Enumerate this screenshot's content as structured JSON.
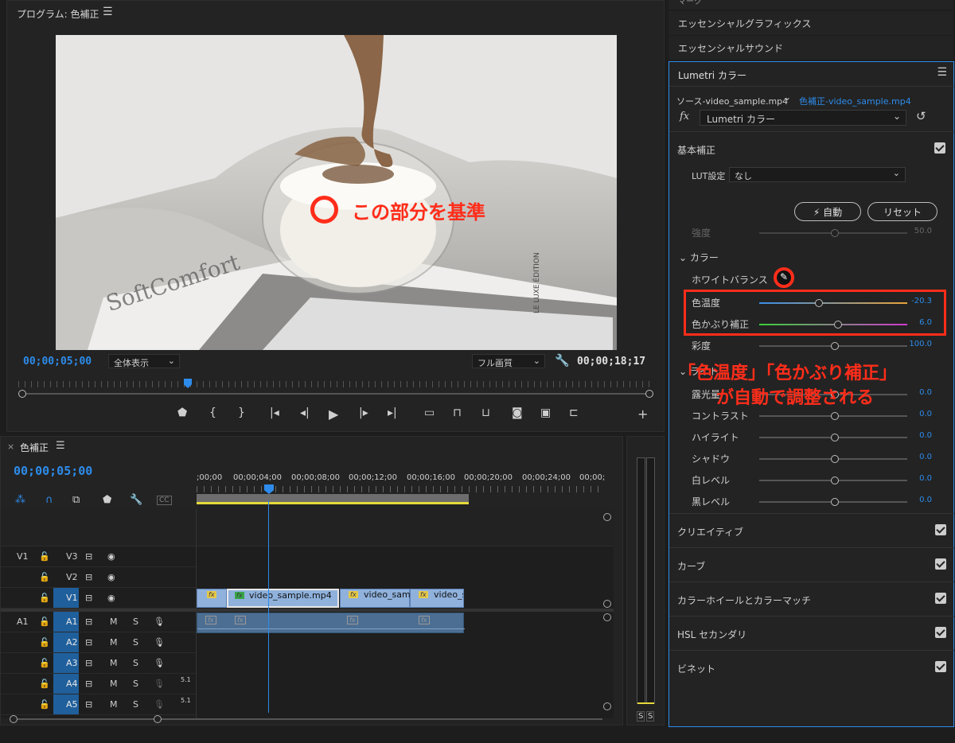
{
  "program": {
    "title": "プログラム: 色補正",
    "timecode_left": "00;00;05;00",
    "fit": "全体表示",
    "quality": "フル画質",
    "timecode_right": "00;00;18;17",
    "overlay_text": "この部分を基準",
    "cover_text": "SoftComfort",
    "side_text": "LE LUXE ÉDITION"
  },
  "annotation": {
    "line1": "「色温度」「色かぶり補正」",
    "line2": "が自動で調整される"
  },
  "right_panels": {
    "top_cut": "マーク",
    "item1": "エッセンシャルグラフィックス",
    "item2": "エッセンシャルサウンド"
  },
  "lumetri": {
    "title": "Lumetri カラー",
    "source": "ソース-video_sample.mp4",
    "target": "色補正-video_sample.mp4",
    "fx_label": "fx",
    "effect": "Lumetri カラー",
    "basic": "基本補正",
    "lut_label": "LUT設定",
    "lut_value": "なし",
    "auto": "自動",
    "reset": "リセット",
    "intensity": {
      "label": "強度",
      "value": "50.0",
      "level": 0.5
    },
    "color_section": "カラー",
    "white_balance": "ホワイトバランス",
    "temp": {
      "label": "色温度",
      "value": "-20.3",
      "level": 0.4
    },
    "tint": {
      "label": "色かぶり補正",
      "value": "6.0",
      "level": 0.53
    },
    "saturation": {
      "label": "彩度",
      "value": "100.0",
      "level": 0.5
    },
    "light_section": "ライト",
    "exposure": {
      "label": "露光量",
      "value": "0.0",
      "level": 0.5
    },
    "contrast": {
      "label": "コントラスト",
      "value": "0.0",
      "level": 0.5
    },
    "highlight": {
      "label": "ハイライト",
      "value": "0.0",
      "level": 0.5
    },
    "shadow": {
      "label": "シャドウ",
      "value": "0.0",
      "level": 0.5
    },
    "white": {
      "label": "白レベル",
      "value": "0.0",
      "level": 0.5
    },
    "black": {
      "label": "黒レベル",
      "value": "0.0",
      "level": 0.5
    },
    "sections": [
      "クリエイティブ",
      "カーブ",
      "カラーホイールとカラーマッチ",
      "HSL セカンダリ",
      "ビネット"
    ]
  },
  "timeline": {
    "close": "×",
    "title": "色補正",
    "timecode": "00;00;05;00",
    "ruler": [
      ";00;00",
      "00;00;04;00",
      "00;00;08;00",
      "00;00;12;00",
      "00;00;16;00",
      "00;00;20;00",
      "00;00;24;00",
      "00;00;"
    ],
    "tracks_video": [
      {
        "src": "V1",
        "name": "V3"
      },
      {
        "src": "",
        "name": "V2"
      },
      {
        "src": "",
        "name": "V1"
      }
    ],
    "tracks_audio": [
      {
        "src": "A1",
        "name": "A1",
        "m": "M",
        "s": "S",
        "ch": ""
      },
      {
        "src": "",
        "name": "A2",
        "m": "M",
        "s": "S",
        "ch": ""
      },
      {
        "src": "",
        "name": "A3",
        "m": "M",
        "s": "S",
        "ch": ""
      },
      {
        "src": "",
        "name": "A4",
        "m": "M",
        "s": "S",
        "ch": "5.1"
      },
      {
        "src": "",
        "name": "A5",
        "m": "M",
        "s": "S",
        "ch": "5.1"
      }
    ],
    "clips": [
      "video_sample.mp4",
      "video_sam",
      "video_s"
    ],
    "fx": "fx",
    "meter_s1": "S",
    "meter_s2": "S",
    "cc": "CC"
  }
}
